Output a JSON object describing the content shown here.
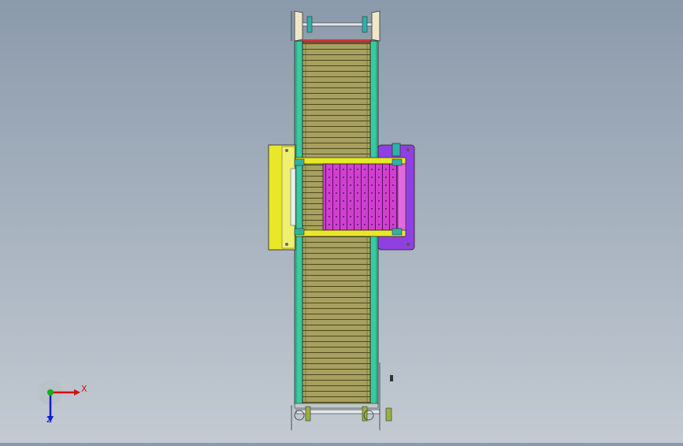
{
  "view": {
    "background_top": "#8b9aab",
    "background_bottom": "#c3cad2",
    "conveyor_color": "#a8a060",
    "rail_color": "#3cc8a0",
    "module_color": "#d040d0",
    "side_frame_color": "#e8e828",
    "motor_frame_color": "#9040e0"
  },
  "triad": {
    "x_label": "X",
    "z_label": "Z",
    "x_color": "#d01010",
    "y_color": "#10b010",
    "z_color": "#1020c0"
  }
}
